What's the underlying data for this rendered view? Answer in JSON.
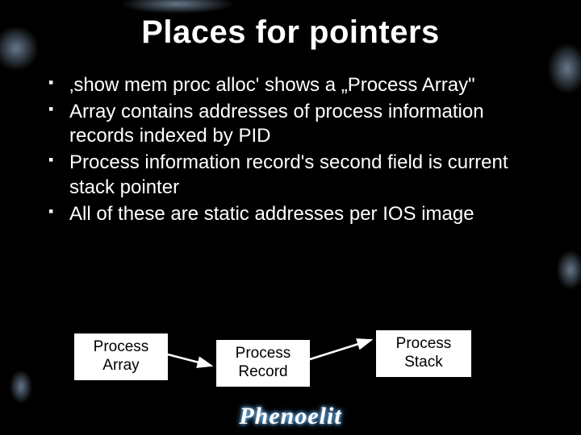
{
  "title": "Places for pointers",
  "bullets": [
    "‚show mem proc alloc' shows a „Process Array\"",
    "Array contains addresses of process information records indexed by PID",
    "Process information record's second field is current stack pointer",
    "All of these are static addresses per IOS image"
  ],
  "boxes": {
    "b1": "Process\nArray",
    "b2": "Process\nRecord",
    "b3": "Process\nStack"
  },
  "logo": "Phenoelit"
}
